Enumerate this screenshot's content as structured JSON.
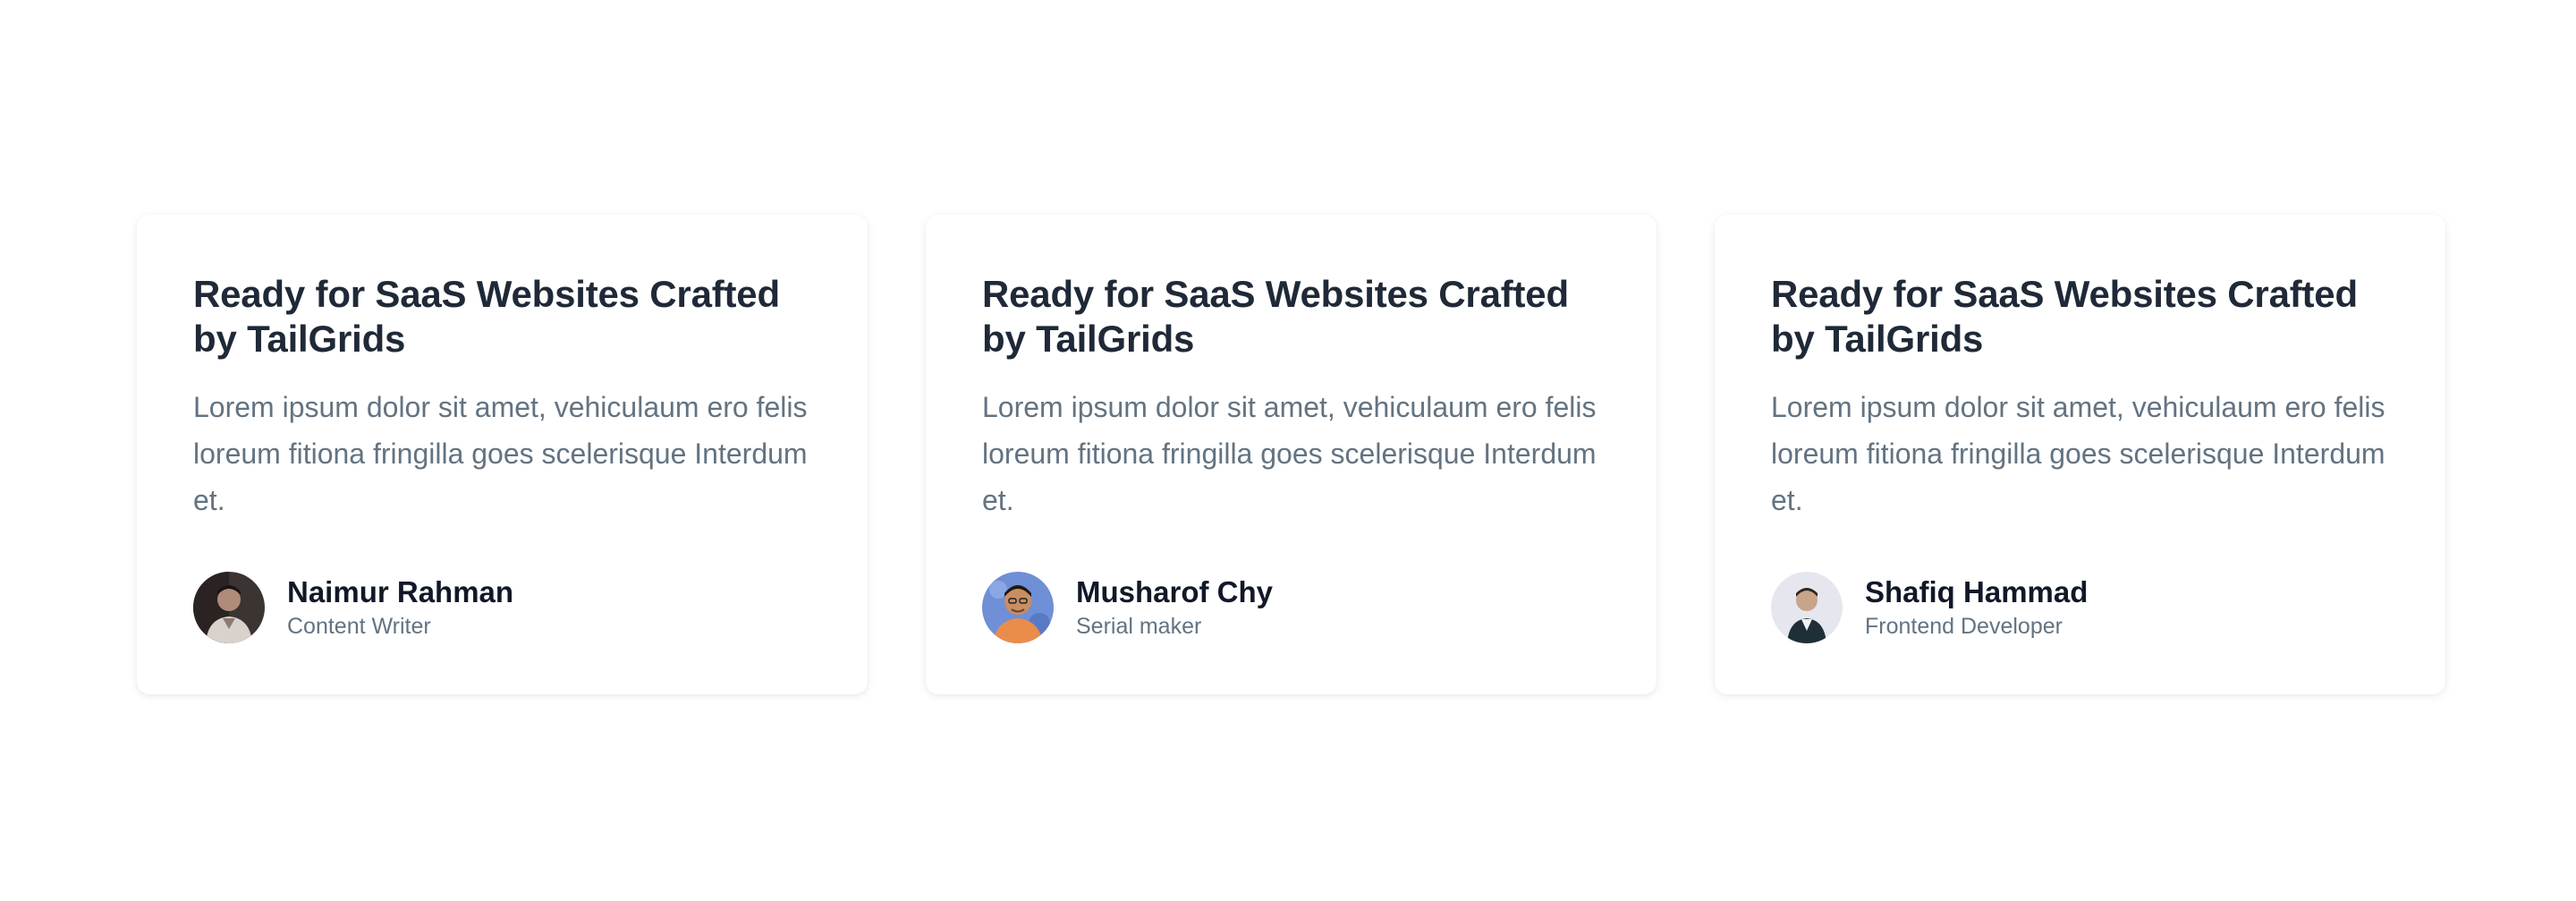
{
  "cards": [
    {
      "title": "Ready for SaaS Websites Crafted by TailGrids",
      "body": "Lorem ipsum dolor sit amet, vehiculaum ero felis loreum fitiona fringilla goes scelerisque Interdum et.",
      "author": {
        "name": "Naimur Rahman",
        "role": "Content Writer",
        "avatar_icon": "person-avatar-dark"
      }
    },
    {
      "title": "Ready for SaaS Websites Crafted by TailGrids",
      "body": "Lorem ipsum dolor sit amet, vehiculaum ero felis loreum fitiona fringilla goes scelerisque Interdum et.",
      "author": {
        "name": "Musharof Chy",
        "role": "Serial maker",
        "avatar_icon": "person-avatar-blue"
      }
    },
    {
      "title": "Ready for SaaS Websites Crafted by TailGrids",
      "body": "Lorem ipsum dolor sit amet, vehiculaum ero felis loreum fitiona fringilla goes scelerisque Interdum et.",
      "author": {
        "name": "Shafiq Hammad",
        "role": "Frontend Developer",
        "avatar_icon": "person-avatar-light"
      }
    }
  ],
  "colors": {
    "title": "#1f2937",
    "body": "#637381",
    "name": "#111827",
    "card_bg": "#ffffff"
  }
}
